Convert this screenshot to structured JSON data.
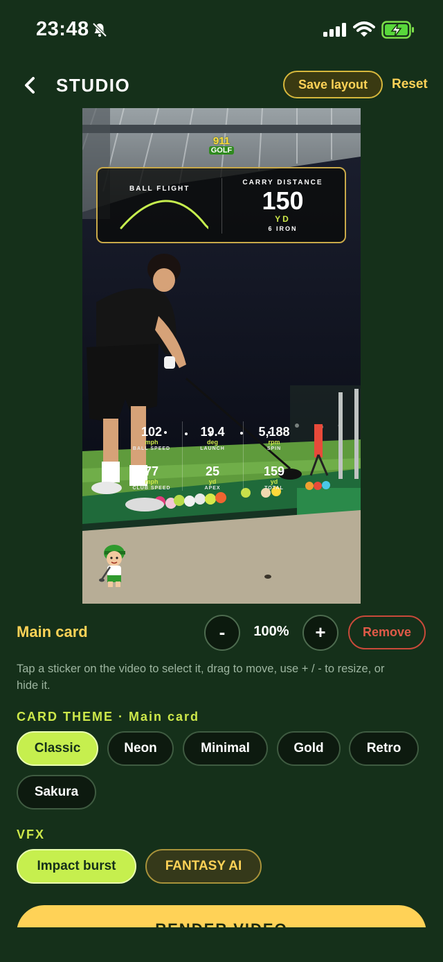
{
  "status_bar": {
    "time": "23:48"
  },
  "header": {
    "title": "STUDIO",
    "save_label": "Save layout",
    "reset_label": "Reset"
  },
  "video": {
    "logo_top": "911",
    "logo_bottom": "GOLF",
    "main_card": {
      "ball_flight_label": "BALL FLIGHT",
      "carry_label": "CARRY DISTANCE",
      "carry_value": "150",
      "carry_unit": "YD",
      "club": "6 IRON"
    },
    "stats": [
      {
        "value": "102",
        "unit": "mph",
        "label": "BALL SPEED"
      },
      {
        "value": "19.4",
        "unit": "deg",
        "label": "LAUNCH"
      },
      {
        "value": "5,188",
        "unit": "rpm",
        "label": "SPIN"
      },
      {
        "value": "77",
        "unit": "mph",
        "label": "CLUB SPEED"
      },
      {
        "value": "25",
        "unit": "yd",
        "label": "APEX"
      },
      {
        "value": "159",
        "unit": "yd",
        "label": "TOTAL"
      }
    ]
  },
  "controls": {
    "selected_name": "Main card",
    "minus_label": "-",
    "zoom": "100%",
    "plus_label": "+",
    "remove_label": "Remove",
    "hint": "Tap a sticker on the video to select it, drag to move, use + / - to resize, or hide it."
  },
  "card_theme": {
    "label": "CARD THEME · Main card",
    "options": [
      "Classic",
      "Neon",
      "Minimal",
      "Gold",
      "Retro",
      "Sakura"
    ],
    "selected": "Classic"
  },
  "vfx": {
    "label": "VFX",
    "options": [
      "Impact burst",
      "FANTASY AI"
    ],
    "selected": "Impact burst"
  },
  "render_label": "RENDER VIDEO",
  "colors": {
    "background": "#15301a",
    "accent_yellow": "#ffd257",
    "accent_lime": "#c6ef4e",
    "danger": "#e05a48",
    "card_border": "#c9a949"
  }
}
